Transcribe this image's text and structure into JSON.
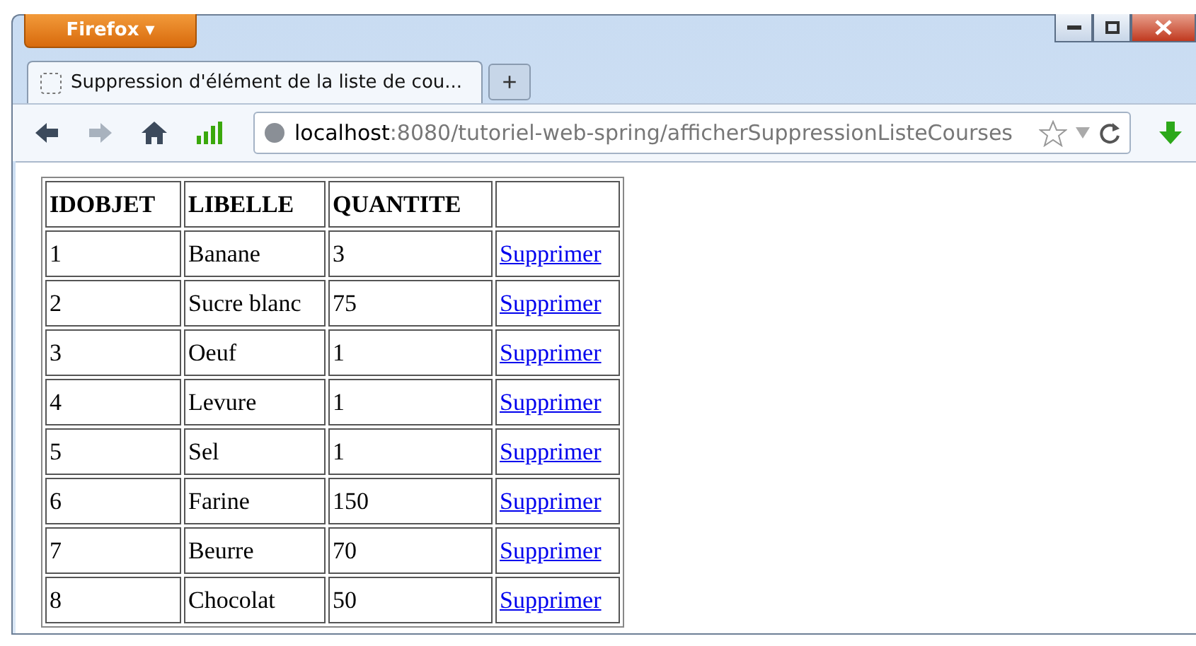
{
  "browser": {
    "menu_button": "Firefox ▾",
    "tab": {
      "title": "Suppression d'élément de la liste de cou...",
      "selected": true
    },
    "new_tab": "+",
    "url": {
      "host": "localhost",
      "rest": ":8080/tutoriel-web-spring/afficherSuppressionListeCourses"
    }
  },
  "table": {
    "columns": [
      "IDOBJET",
      "LIBELLE",
      "QUANTITE",
      ""
    ],
    "rows": [
      [
        "1",
        "Banane",
        "3",
        "Supprimer"
      ],
      [
        "2",
        "Sucre blanc",
        "75",
        "Supprimer"
      ],
      [
        "3",
        "Oeuf",
        "1",
        "Supprimer"
      ],
      [
        "4",
        "Levure",
        "1",
        "Supprimer"
      ],
      [
        "5",
        "Sel",
        "1",
        "Supprimer"
      ],
      [
        "6",
        "Farine",
        "150",
        "Supprimer"
      ],
      [
        "7",
        "Beurre",
        "70",
        "Supprimer"
      ],
      [
        "8",
        "Chocolat",
        "50",
        "Supprimer"
      ]
    ]
  }
}
